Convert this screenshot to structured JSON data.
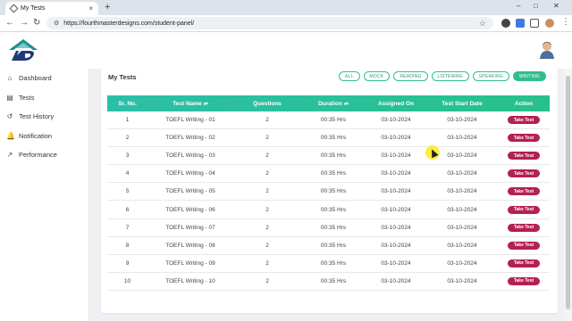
{
  "browser": {
    "tab_title": "My Tests",
    "tab_close": "×",
    "new_tab": "+",
    "url": "https://fourthmasterdesigns.com/student-panel/",
    "window_controls": [
      "–",
      "□",
      "✕"
    ]
  },
  "sidebar": {
    "items": [
      {
        "label": "Dashboard",
        "icon": "⌂"
      },
      {
        "label": "Tests",
        "icon": "▤"
      },
      {
        "label": "Test History",
        "icon": "↺"
      },
      {
        "label": "Notification",
        "icon": "🔔"
      },
      {
        "label": "Performance",
        "icon": "↗"
      }
    ]
  },
  "main": {
    "title": "My Tests",
    "filters": [
      "ALL",
      "MOCK",
      "READING",
      "LISTENING",
      "SPEAKING",
      "WRITING"
    ],
    "active_filter": "WRITING",
    "columns": [
      "Sr. No.",
      "Test Name",
      "Questions",
      "Duration",
      "Assigned On",
      "Test Start Date",
      "Action"
    ],
    "sort_icon": "⇌",
    "action_label": "Take Test",
    "rows": [
      {
        "sr": "1",
        "name": "TOEFL Writing - 01",
        "questions": "2",
        "duration": "00:35 Hrs",
        "assigned": "03-10-2024",
        "start": "03-10-2024"
      },
      {
        "sr": "2",
        "name": "TOEFL Writing - 02",
        "questions": "2",
        "duration": "00:35 Hrs",
        "assigned": "03-10-2024",
        "start": "03-10-2024"
      },
      {
        "sr": "3",
        "name": "TOEFL Writing - 03",
        "questions": "2",
        "duration": "00:35 Hrs",
        "assigned": "03-10-2024",
        "start": "03-10-2024"
      },
      {
        "sr": "4",
        "name": "TOEFL Writing - 04",
        "questions": "2",
        "duration": "00:35 Hrs",
        "assigned": "03-10-2024",
        "start": "03-10-2024"
      },
      {
        "sr": "5",
        "name": "TOEFL Writing - 05",
        "questions": "2",
        "duration": "00:35 Hrs",
        "assigned": "03-10-2024",
        "start": "03-10-2024"
      },
      {
        "sr": "6",
        "name": "TOEFL Writing - 06",
        "questions": "2",
        "duration": "00:35 Hrs",
        "assigned": "03-10-2024",
        "start": "03-10-2024"
      },
      {
        "sr": "7",
        "name": "TOEFL Writing - 07",
        "questions": "2",
        "duration": "00:35 Hrs",
        "assigned": "03-10-2024",
        "start": "03-10-2024"
      },
      {
        "sr": "8",
        "name": "TOEFL Writing - 08",
        "questions": "2",
        "duration": "00:35 Hrs",
        "assigned": "03-10-2024",
        "start": "03-10-2024"
      },
      {
        "sr": "9",
        "name": "TOEFL Writing - 09",
        "questions": "2",
        "duration": "00:35 Hrs",
        "assigned": "03-10-2024",
        "start": "03-10-2024"
      },
      {
        "sr": "10",
        "name": "TOEFL Writing - 10",
        "questions": "2",
        "duration": "00:35 Hrs",
        "assigned": "03-10-2024",
        "start": "03-10-2024"
      }
    ]
  },
  "colors": {
    "accent_green": "#28c08a",
    "action_red": "#b3214e"
  }
}
